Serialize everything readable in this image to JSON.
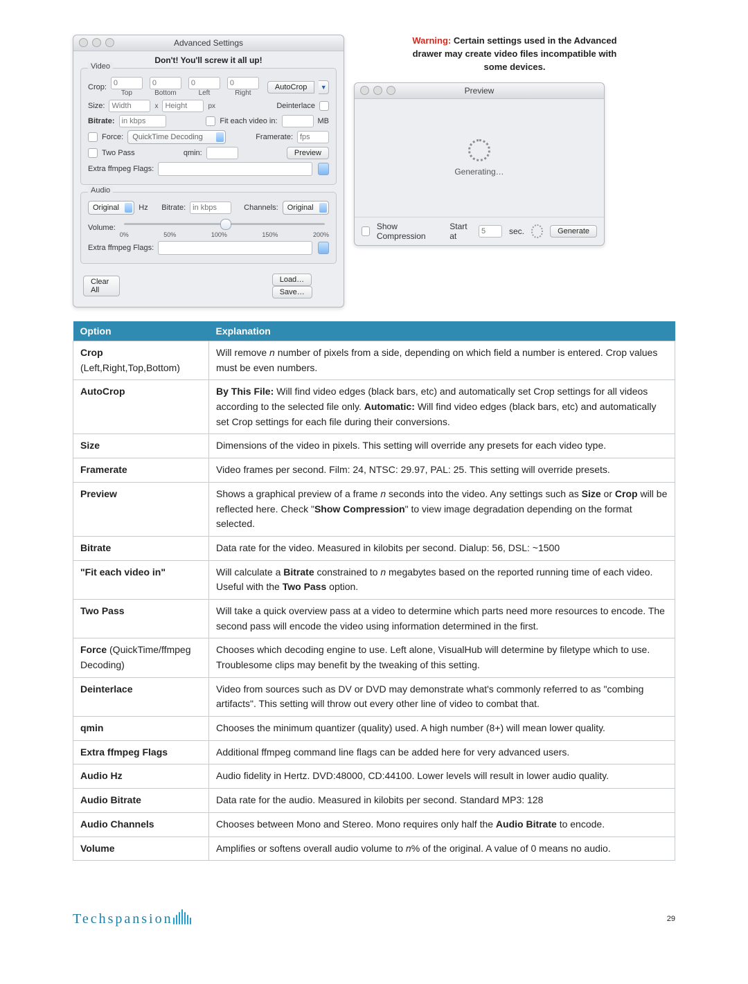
{
  "adv_window": {
    "title": "Advanced Settings",
    "screw": "Don't! You'll screw it all up!",
    "video": {
      "group": "Video",
      "crop_label": "Crop:",
      "crop_fields": [
        {
          "value": "0",
          "caption": "Top"
        },
        {
          "value": "0",
          "caption": "Bottom"
        },
        {
          "value": "0",
          "caption": "Left"
        },
        {
          "value": "0",
          "caption": "Right"
        }
      ],
      "autocrop": "AutoCrop",
      "size_label": "Size:",
      "width_ph": "Width",
      "height_ph": "Height",
      "x": "x",
      "px": "px",
      "deinterlace": "Deinterlace",
      "bitrate_label": "Bitrate:",
      "bitrate_ph": "in kbps",
      "fit_label": "Fit each video in:",
      "fit_unit": "MB",
      "force_label": "Force:",
      "force_value": "QuickTime Decoding",
      "framerate_label": "Framerate:",
      "framerate_ph": "fps",
      "twopass": "Two Pass",
      "qmin_label": "qmin:",
      "preview_btn": "Preview",
      "flags_label": "Extra ffmpeg Flags:"
    },
    "audio": {
      "group": "Audio",
      "hz_value": "Original",
      "hz_unit": "Hz",
      "bitrate_label": "Bitrate:",
      "bitrate_ph": "in kbps",
      "channels_label": "Channels:",
      "channels_value": "Original",
      "volume_label": "Volume:",
      "ticks": [
        "0%",
        "50%",
        "100%",
        "150%",
        "200%"
      ],
      "flags_label": "Extra ffmpeg Flags:"
    },
    "clear": "Clear All",
    "load": "Load…",
    "save": "Save…"
  },
  "warning": {
    "red": "Warning:",
    "rest1": " Certain settings used in the Advanced",
    "line2": "drawer may create video files incompatible with",
    "line3": "some devices."
  },
  "preview_window": {
    "title": "Preview",
    "generating": "Generating…",
    "showcomp": "Show Compression",
    "startat": "Start at",
    "start_value": "5",
    "sec": "sec.",
    "generate": "Generate"
  },
  "table": {
    "head_option": "Option",
    "head_expl": "Explanation",
    "rows": [
      {
        "opt_html": "<b>Crop</b><br><span class='light'>(Left,Right,Top,Bottom)</span>",
        "exp_html": "Will remove <i>n</i> number of pixels from a side, depending on which field a number is entered. Crop values must be even numbers."
      },
      {
        "opt_html": "<b>AutoCrop</b>",
        "exp_html": "<b>By This File:</b> Will find video edges (black bars, etc) and automatically set Crop settings for all videos according to the selected file only. <b>Automatic:</b> Will find video edges (black bars, etc) and automatically set Crop settings for each file during their conversions."
      },
      {
        "opt_html": "<b>Size</b>",
        "exp_html": "Dimensions of the video in pixels. This setting will override any presets for each video type."
      },
      {
        "opt_html": "<b>Framerate</b>",
        "exp_html": "Video frames per second. Film: 24, NTSC: 29.97, PAL: 25. This setting will override presets."
      },
      {
        "opt_html": "<b>Preview</b>",
        "exp_html": "Shows a graphical preview of a frame <i>n</i> seconds into the video. Any settings such as <b>Size</b> or <b>Crop</b> will be reflected here. Check \"<b>Show Compression</b>\" to view image degradation depending on the format selected."
      },
      {
        "opt_html": "<b>Bitrate</b>",
        "exp_html": "Data rate for the video. Measured in kilobits per second. Dialup: 56, DSL: ~1500"
      },
      {
        "opt_html": "<b>\"Fit each video in\"</b>",
        "exp_html": "Will calculate a <b>Bitrate</b> constrained to <i>n</i> megabytes based on the reported running time of each video. Useful with the <b>Two Pass</b> option."
      },
      {
        "opt_html": "<b>Two Pass</b>",
        "exp_html": "Will take a quick overview pass at a video to determine which parts need more resources to encode. The second pass will encode the video using information determined in the first."
      },
      {
        "opt_html": "<b>Force</b> <span class='light'>(QuickTime/ffmpeg Decoding)</span>",
        "exp_html": "Chooses which decoding engine to use. Left alone, VisualHub will determine by filetype which to use. Troublesome clips may benefit by the tweaking of this setting."
      },
      {
        "opt_html": "<b>Deinterlace</b>",
        "exp_html": "Video from sources such as DV or DVD may demonstrate what's commonly referred to as \"combing artifacts\". This setting will throw out every other line of video to combat that."
      },
      {
        "opt_html": "<b>qmin</b>",
        "exp_html": "Chooses the minimum quantizer (quality) used. A high number (8+) will mean lower quality."
      },
      {
        "opt_html": "<b>Extra ffmpeg Flags</b>",
        "exp_html": "Additional ffmpeg command line flags can be added here for very advanced users."
      },
      {
        "opt_html": "<b>Audio Hz</b>",
        "exp_html": "Audio fidelity in Hertz. DVD:48000, CD:44100. Lower levels will result in lower audio quality."
      },
      {
        "opt_html": "<b>Audio Bitrate</b>",
        "exp_html": "Data rate for the audio. Measured in kilobits per second. Standard MP3: 128"
      },
      {
        "opt_html": "<b>Audio Channels</b>",
        "exp_html": "Chooses between Mono and Stereo. Mono requires only half the <b>Audio Bitrate</b> to encode."
      },
      {
        "opt_html": "<b>Volume</b>",
        "exp_html": "Amplifies or softens overall audio volume to <i>n</i>% of the original. A value of 0 means no audio."
      }
    ]
  },
  "footer": {
    "brand": "Techspansion",
    "page": "29"
  }
}
